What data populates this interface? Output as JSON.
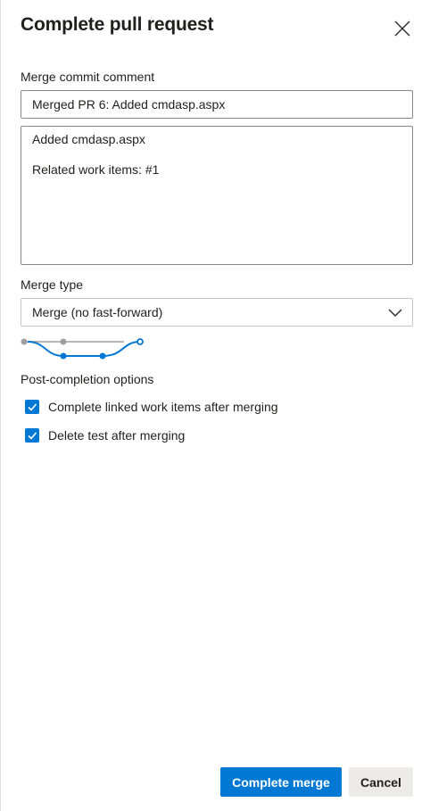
{
  "dialog": {
    "title": "Complete pull request",
    "close_icon": "close-icon"
  },
  "commit": {
    "label": "Merge commit comment",
    "title_value": "Merged PR 6: Added cmdasp.aspx",
    "body_lines": [
      "Added cmdasp.aspx",
      "",
      "Related work items: #1"
    ]
  },
  "merge_type": {
    "label": "Merge type",
    "selected": "Merge (no fast-forward)",
    "chevron_icon": "chevron-down-icon"
  },
  "post_completion": {
    "label": "Post-completion options",
    "options": [
      {
        "label": "Complete linked work items after merging",
        "checked": true
      },
      {
        "label": "Delete test after merging",
        "checked": true
      }
    ]
  },
  "actions": {
    "complete_label": "Complete merge",
    "cancel_label": "Cancel"
  },
  "colors": {
    "accent": "#0078d4",
    "text": "#201f1e",
    "diagram_gray": "#a19f9d"
  }
}
